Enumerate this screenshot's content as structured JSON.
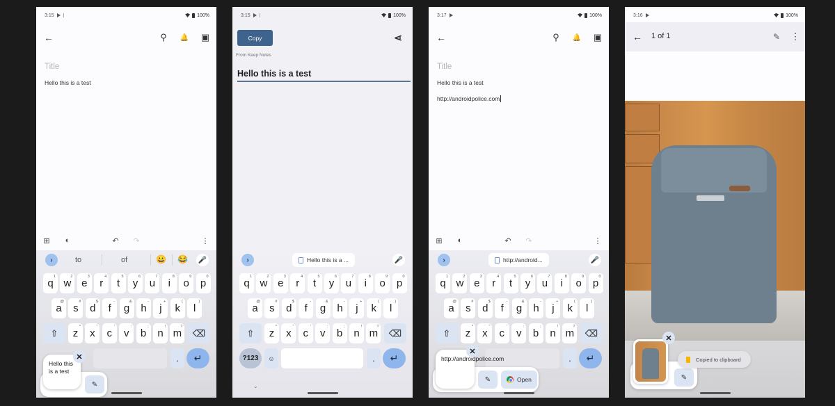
{
  "status_bar": {
    "battery": "100%"
  },
  "phone1": {
    "time": "3:15",
    "title_placeholder": "Title",
    "note_body": "Hello this is a test",
    "suggestions": [
      "to",
      "of"
    ],
    "emojis": [
      "😀",
      "😂"
    ],
    "clip_preview": "Hello this is a test"
  },
  "phone2": {
    "time": "3:15",
    "copy_button": "Copy",
    "source_label": "From Keep Notes",
    "edit_text": "Hello this is a test",
    "clip_chip": "Hello this is a ...",
    "symbols_key": "?123"
  },
  "phone3": {
    "time": "3:17",
    "title_placeholder": "Title",
    "note_body": "Hello this is a test",
    "note_link": "http://androidpolice.com",
    "clip_chip": "http://android...",
    "clip_preview": "http://androidpolice.com",
    "open_button": "Open"
  },
  "phone4": {
    "time": "3:16",
    "page_label": "1 of 1",
    "toast": "Copied to clipboard"
  },
  "keyboard": {
    "row1": [
      {
        "k": "q",
        "s": "1"
      },
      {
        "k": "w",
        "s": "2"
      },
      {
        "k": "e",
        "s": "3"
      },
      {
        "k": "r",
        "s": "4"
      },
      {
        "k": "t",
        "s": "5"
      },
      {
        "k": "y",
        "s": "6"
      },
      {
        "k": "u",
        "s": "7"
      },
      {
        "k": "i",
        "s": "8"
      },
      {
        "k": "o",
        "s": "9"
      },
      {
        "k": "p",
        "s": "0"
      }
    ],
    "row2": [
      {
        "k": "a",
        "s": "@"
      },
      {
        "k": "s",
        "s": "#"
      },
      {
        "k": "d",
        "s": "$"
      },
      {
        "k": "f",
        "s": "-"
      },
      {
        "k": "g",
        "s": "&"
      },
      {
        "k": "h",
        "s": "-"
      },
      {
        "k": "j",
        "s": "+"
      },
      {
        "k": "k",
        "s": "("
      },
      {
        "k": "l",
        "s": ")"
      }
    ],
    "row3": [
      {
        "k": "z",
        "s": "*"
      },
      {
        "k": "x",
        "s": "\""
      },
      {
        "k": "c",
        "s": "'"
      },
      {
        "k": "v",
        "s": ":"
      },
      {
        "k": "b",
        "s": ";"
      },
      {
        "k": "n",
        "s": "!"
      },
      {
        "k": "m",
        "s": "?"
      }
    ],
    "period": "."
  },
  "icons": {
    "back": "←",
    "pin": "⚲",
    "reminder": "🔔",
    "archive": "▣",
    "share": "⋖",
    "more": "⋮",
    "add_box": "⊞",
    "palette": "◐",
    "undo": "↶",
    "redo": "↷",
    "expand": "›",
    "mic": "🎤",
    "shift": "⇧",
    "backspace": "⌫",
    "enter": "↵",
    "close": "✕",
    "edit": "✎",
    "chevron_down": "⌄",
    "emoji_key": "☺"
  }
}
